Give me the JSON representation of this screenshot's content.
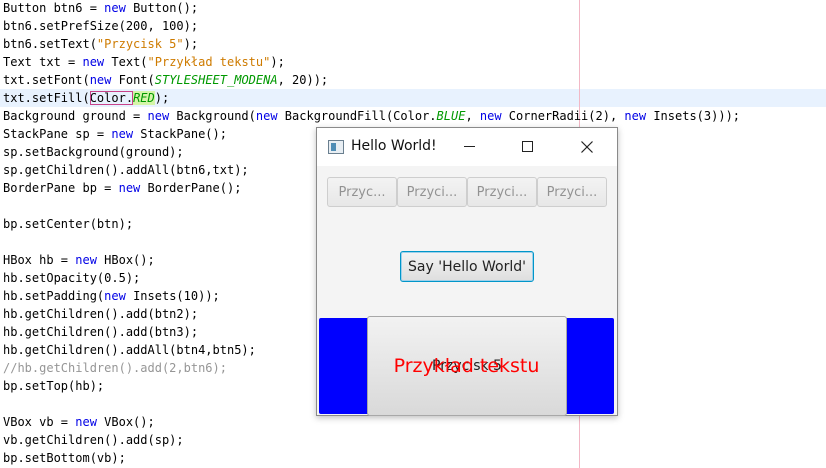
{
  "editor": {
    "lines": [
      [
        {
          "t": "Button btn6 = "
        },
        {
          "t": "new",
          "c": "kw"
        },
        {
          "t": " Button();"
        }
      ],
      [
        {
          "t": "btn6.setPrefSize(200, 100);"
        }
      ],
      [
        {
          "t": "btn6.setText("
        },
        {
          "t": "\"Przycisk 5\"",
          "c": "str"
        },
        {
          "t": ");"
        }
      ],
      [
        {
          "t": "Text txt = "
        },
        {
          "t": "new",
          "c": "kw"
        },
        {
          "t": " Text("
        },
        {
          "t": "\"Przykład tekstu\"",
          "c": "str"
        },
        {
          "t": ");"
        }
      ],
      [
        {
          "t": "txt.setFont("
        },
        {
          "t": "new",
          "c": "kw"
        },
        {
          "t": " Font("
        },
        {
          "t": "STYLESHEET_MODENA",
          "c": "const"
        },
        {
          "t": ", 20));"
        }
      ],
      [
        {
          "t": "txt.setFill("
        },
        {
          "t": "Color.",
          "c": "box"
        },
        {
          "t": "RED",
          "c": "hl"
        },
        {
          "t": ");"
        }
      ],
      [
        {
          "t": "Background ground = "
        },
        {
          "t": "new",
          "c": "kw"
        },
        {
          "t": " Background("
        },
        {
          "t": "new",
          "c": "kw"
        },
        {
          "t": " BackgroundFill(Color."
        },
        {
          "t": "BLUE",
          "c": "const"
        },
        {
          "t": ", "
        },
        {
          "t": "new",
          "c": "kw"
        },
        {
          "t": " CornerRadii(2), "
        },
        {
          "t": "new",
          "c": "kw"
        },
        {
          "t": " Insets(3)));"
        }
      ],
      [
        {
          "t": "StackPane sp = "
        },
        {
          "t": "new",
          "c": "kw"
        },
        {
          "t": " StackPane();"
        }
      ],
      [
        {
          "t": "sp.setBackground(ground);"
        }
      ],
      [
        {
          "t": "sp.getChildren().addAll(btn6,txt);"
        }
      ],
      [
        {
          "t": "BorderPane bp = "
        },
        {
          "t": "new",
          "c": "kw"
        },
        {
          "t": " BorderPane();"
        }
      ],
      [],
      [
        {
          "t": "bp.setCenter(btn);"
        }
      ],
      [],
      [
        {
          "t": "HBox hb = "
        },
        {
          "t": "new",
          "c": "kw"
        },
        {
          "t": " HBox();"
        }
      ],
      [
        {
          "t": "hb.setOpacity(0.5);"
        }
      ],
      [
        {
          "t": "hb.setPadding("
        },
        {
          "t": "new",
          "c": "kw"
        },
        {
          "t": " Insets(10));"
        }
      ],
      [
        {
          "t": "hb.getChildren().add(btn2);"
        }
      ],
      [
        {
          "t": "hb.getChildren().add(btn3);"
        }
      ],
      [
        {
          "t": "hb.getChildren().addAll(btn4,btn5);"
        }
      ],
      [
        {
          "t": "//hb.getChildren().add(2,btn6);",
          "c": "cmt"
        }
      ],
      [
        {
          "t": "bp.setTop(hb);"
        }
      ],
      [],
      [
        {
          "t": "VBox vb = "
        },
        {
          "t": "new",
          "c": "kw"
        },
        {
          "t": " VBox();"
        }
      ],
      [
        {
          "t": "vb.getChildren().add(sp);"
        }
      ],
      [
        {
          "t": "bp.setBottom(vb);"
        }
      ]
    ],
    "current_line": 5
  },
  "window": {
    "title": "Hello World!",
    "top_buttons": [
      "Przyc...",
      "Przyci...",
      "Przyci...",
      "Przyci..."
    ],
    "center_button": "Say 'Hello World'",
    "bottom_button": "Przycisk 5",
    "bottom_text": "Przykład tekstu",
    "colors": {
      "stack_background": "#0000ff",
      "text_fill": "#ff0000",
      "focus_border": "#0096c9"
    }
  }
}
